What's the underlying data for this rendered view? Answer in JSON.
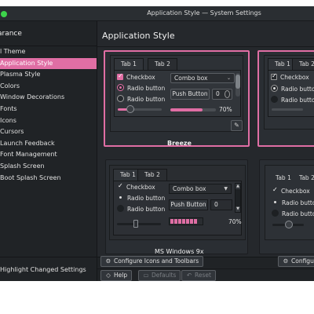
{
  "window": {
    "title": "Application Style — System Settings"
  },
  "sidebar": {
    "header": "arance",
    "items": [
      {
        "label": "l Theme"
      },
      {
        "label": "Application Style"
      },
      {
        "label": "Plasma Style"
      },
      {
        "label": "Colors"
      },
      {
        "label": "Window Decorations"
      },
      {
        "label": "Fonts"
      },
      {
        "label": "Icons"
      },
      {
        "label": "Cursors"
      },
      {
        "label": "Launch Feedback"
      },
      {
        "label": "Font Management"
      },
      {
        "label": "Splash Screen"
      },
      {
        "label": "Boot Splash Screen"
      }
    ],
    "highlight_changed": "Highlight Changed Settings"
  },
  "content": {
    "title": "Application Style"
  },
  "preview_widgets": {
    "tab1": "Tab 1",
    "tab2": "Tab 2",
    "checkbox": "Checkbox",
    "radio": "Radio button",
    "combo": "Combo box",
    "push": "Push Button",
    "spin_value": "0",
    "percent": "70%",
    "progress": 0.7
  },
  "themes": [
    {
      "name": "Breeze",
      "selected": true
    },
    {
      "name": ""
    },
    {
      "name": "MS Windows 9x"
    },
    {
      "name": ""
    }
  ],
  "actions": {
    "configure_icons": "Configure Icons and Toolbars",
    "configure": "Configu",
    "help": "Help",
    "defaults": "Defaults",
    "reset": "Reset"
  },
  "colors": {
    "accent": "#e06ea4",
    "background": "#202326",
    "content": "#25282c"
  }
}
